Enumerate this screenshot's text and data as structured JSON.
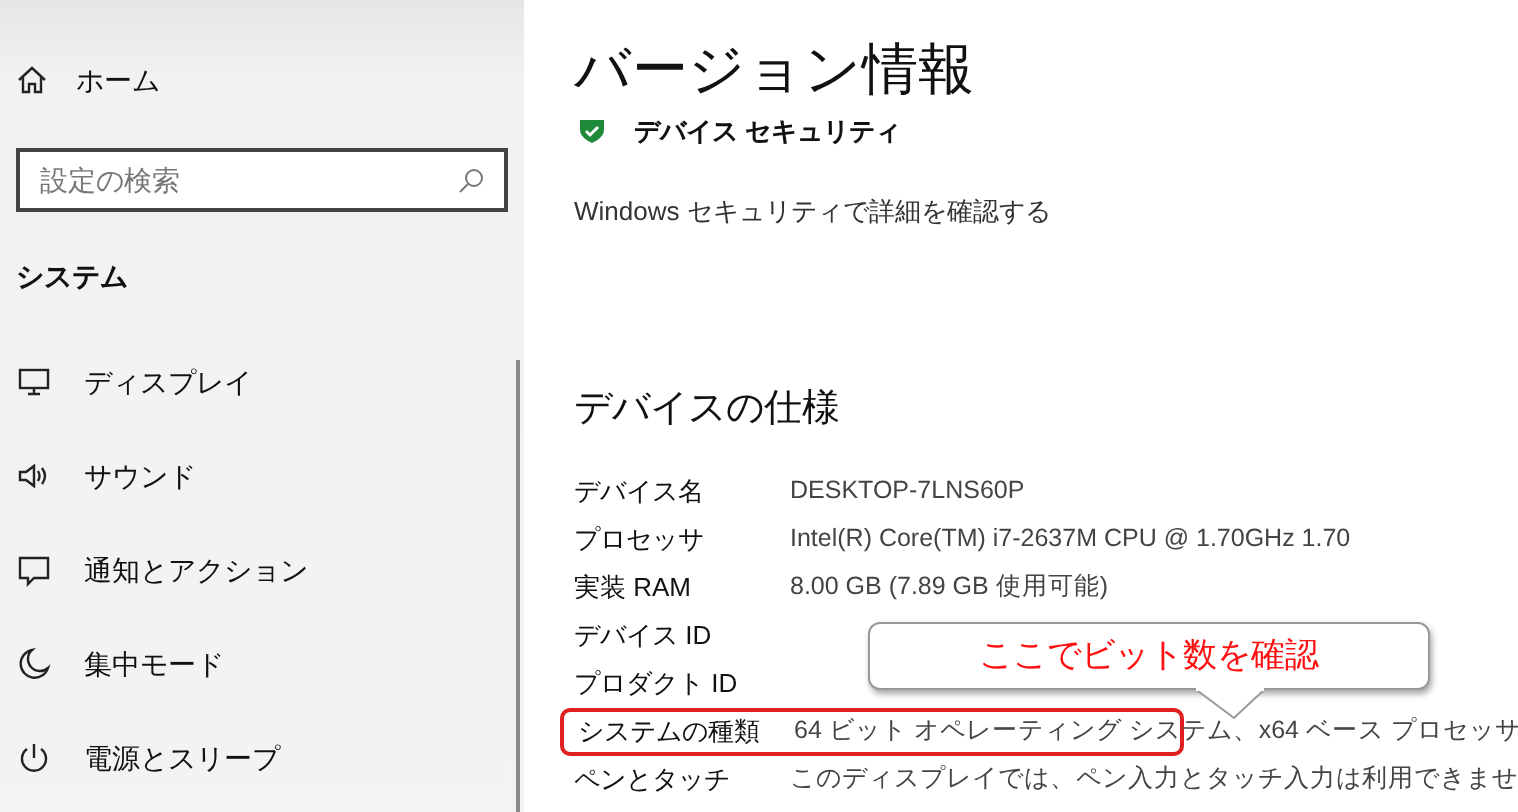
{
  "sidebar": {
    "home": "ホーム",
    "search": {
      "placeholder": "設定の検索"
    },
    "section": "システム",
    "items": [
      {
        "kind": "display",
        "label": "ディスプレイ"
      },
      {
        "kind": "sound",
        "label": "サウンド"
      },
      {
        "kind": "notification",
        "label": "通知とアクション"
      },
      {
        "kind": "focus",
        "label": "集中モード"
      },
      {
        "kind": "power",
        "label": "電源とスリープ"
      }
    ]
  },
  "main": {
    "title": "バージョン情報",
    "security": {
      "label": "デバイス セキュリティ",
      "link": "Windows セキュリティで詳細を確認する"
    },
    "specs_heading": "デバイスの仕様",
    "specs": [
      {
        "label": "デバイス名",
        "value": "DESKTOP-7LNS60P",
        "highlighted": false
      },
      {
        "label": "プロセッサ",
        "value": "Intel(R) Core(TM) i7-2637M CPU @ 1.70GHz   1.70",
        "highlighted": false
      },
      {
        "label": "実装 RAM",
        "value": "8.00 GB (7.89 GB 使用可能)",
        "highlighted": false
      },
      {
        "label": "デバイス ID",
        "highlighted": false
      },
      {
        "label": "プロダクト ID",
        "highlighted": false
      },
      {
        "label": "システムの種類",
        "value": "64 ビット オペレーティング システム、x64 ベース プロセッサ",
        "highlighted": true
      },
      {
        "label": "ペンとタッチ",
        "value": "このディスプレイでは、ペン入力とタッチ入力は利用できませ",
        "highlighted": false
      }
    ],
    "callout": "ここでビット数を確認"
  }
}
